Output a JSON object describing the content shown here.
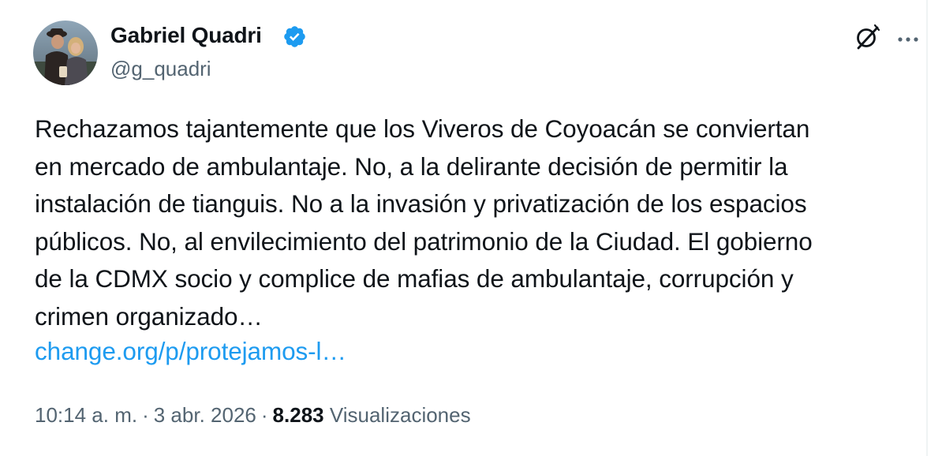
{
  "tweet": {
    "author": {
      "display_name": "Gabriel Quadri",
      "handle": "@g_quadri",
      "verified": true,
      "avatar_icon": "profile-photo"
    },
    "text": "Rechazamos tajantemente que los Viveros de Coyoacán se conviertan\nen mercado de ambulantaje. No, a la delirante decisión de permitir la\ninstalación de tianguis. No a la invasión y privatización de los espacios\npúblicos. No, al envilecimiento del patrimonio de la Ciudad. El gobierno\nde la CDMX socio y complice de mafias de ambulantaje, corrupción y\ncrimen organizado…",
    "link_text": "change.org/p/protejamos-l…",
    "time": "10:14 a. m.",
    "date": "3 abr. 2026",
    "separator": "·",
    "views_count": "8.283",
    "views_label": "Visualizaciones"
  },
  "icons": {
    "verified": "verified-badge-icon",
    "grok": "grok-icon",
    "more": "more-options-icon"
  },
  "colors": {
    "link": "#1d9bf0",
    "verified": "#1d9bf0",
    "text": "#0f1419",
    "secondary": "#536471"
  }
}
